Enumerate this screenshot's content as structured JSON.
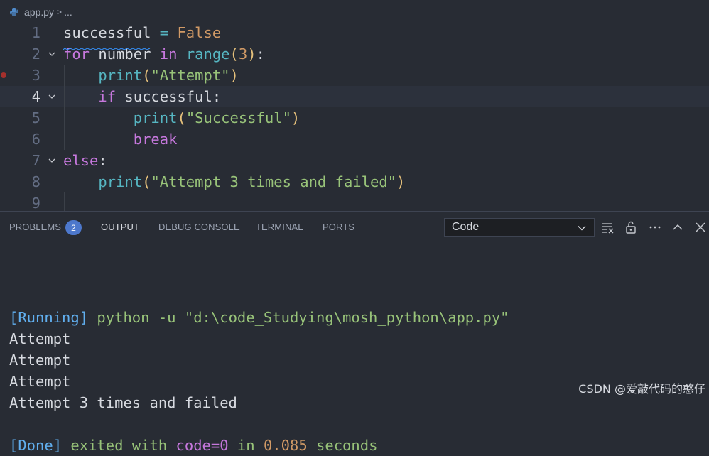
{
  "breadcrumb": {
    "file": "app.py",
    "separator": ">",
    "more": "..."
  },
  "editor": {
    "line_numbers": [
      "1",
      "2",
      "3",
      "4",
      "5",
      "6",
      "7",
      "8",
      "9"
    ],
    "lines": [
      [
        {
          "t": "successful",
          "c": "plain"
        },
        {
          "t": " = ",
          "c": "op"
        },
        {
          "t": "False",
          "c": "bool"
        }
      ],
      [
        {
          "t": "for",
          "c": "kw"
        },
        {
          "t": " number ",
          "c": "plain"
        },
        {
          "t": "in",
          "c": "kw"
        },
        {
          "t": " ",
          "c": "plain"
        },
        {
          "t": "range",
          "c": "fn"
        },
        {
          "t": "(",
          "c": "p1"
        },
        {
          "t": "3",
          "c": "num"
        },
        {
          "t": ")",
          "c": "p1"
        },
        {
          "t": ":",
          "c": "colon"
        }
      ],
      [
        {
          "t": "    ",
          "c": "plain"
        },
        {
          "t": "print",
          "c": "fn"
        },
        {
          "t": "(",
          "c": "p1"
        },
        {
          "t": "\"Attempt\"",
          "c": "str"
        },
        {
          "t": ")",
          "c": "p1"
        }
      ],
      [
        {
          "t": "    ",
          "c": "plain"
        },
        {
          "t": "if",
          "c": "kw"
        },
        {
          "t": " successful:",
          "c": "plain"
        }
      ],
      [
        {
          "t": "        ",
          "c": "plain"
        },
        {
          "t": "print",
          "c": "fn"
        },
        {
          "t": "(",
          "c": "p1"
        },
        {
          "t": "\"Successful\"",
          "c": "str"
        },
        {
          "t": ")",
          "c": "p1"
        }
      ],
      [
        {
          "t": "        ",
          "c": "plain"
        },
        {
          "t": "break",
          "c": "kw"
        }
      ],
      [
        {
          "t": "else",
          "c": "kw"
        },
        {
          "t": ":",
          "c": "colon"
        }
      ],
      [
        {
          "t": "    ",
          "c": "plain"
        },
        {
          "t": "print",
          "c": "fn"
        },
        {
          "t": "(",
          "c": "p1"
        },
        {
          "t": "\"Attempt 3 times and failed\"",
          "c": "str"
        },
        {
          "t": ")",
          "c": "p1"
        }
      ],
      []
    ]
  },
  "panel": {
    "tabs": [
      "PROBLEMS",
      "OUTPUT",
      "DEBUG CONSOLE",
      "TERMINAL",
      "PORTS"
    ],
    "active_tab": "OUTPUT",
    "problems_count": "2",
    "channel_select": "Code",
    "output_lines": [
      [
        {
          "t": "[Running]",
          "c": "running-tag"
        },
        {
          "t": " python -u \"d:\\code_Studying\\mosh_python\\app.py\"",
          "c": "cmd"
        }
      ],
      [
        {
          "t": "Attempt",
          "c": "default-text"
        }
      ],
      [
        {
          "t": "Attempt",
          "c": "default-text"
        }
      ],
      [
        {
          "t": "Attempt",
          "c": "default-text"
        }
      ],
      [
        {
          "t": "Attempt 3 times and failed",
          "c": "default-text"
        }
      ],
      [],
      [
        {
          "t": "[Done]",
          "c": "done-tag"
        },
        {
          "t": " exited with ",
          "c": "exit-text"
        },
        {
          "t": "code=0",
          "c": "code-eq"
        },
        {
          "t": " in ",
          "c": "exit-text"
        },
        {
          "t": "0.085",
          "c": "time-num"
        },
        {
          "t": " seconds",
          "c": "exit-text"
        }
      ]
    ]
  },
  "watermark": "CSDN @爱敲代码的憨仔",
  "colors": {
    "background": "#282c34",
    "current_line": "#2c313c",
    "badge": "#4d78cc",
    "breakpoint": "#a5302c"
  },
  "icons": [
    "python-file-icon",
    "fold-chevron-icon",
    "breakpoint-icon",
    "clear-output-icon",
    "lock-scroll-icon",
    "more-actions-icon",
    "maximize-panel-icon",
    "close-panel-icon"
  ]
}
